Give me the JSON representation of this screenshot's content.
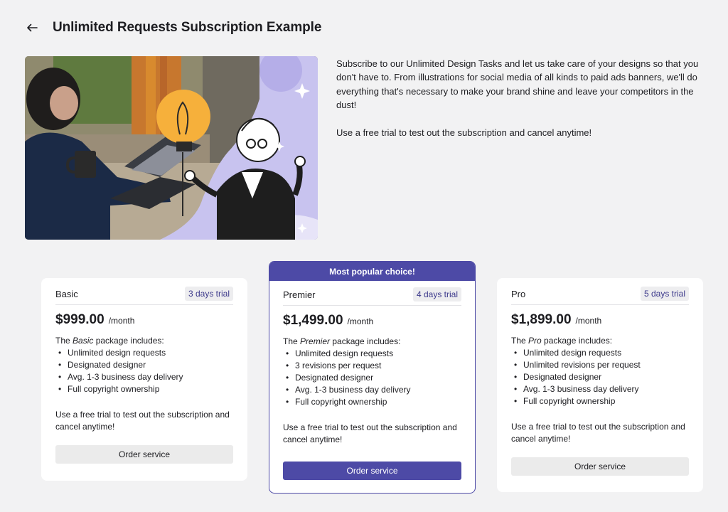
{
  "header": {
    "back_icon": "arrow-left-icon",
    "title": "Unlimited Requests Subscription Example"
  },
  "hero": {
    "image": "illustration-woman-laptop-and-cartoon-character-with-lightbulb"
  },
  "description": {
    "paragraph1": "Subscribe to our Unlimited Design Tasks and let us take care of your designs so that you don't have to. From illustrations for social media of all kinds to paid ads banners, we'll do everything that's necessary to make your brand shine and leave your competitors in the dust!",
    "paragraph2": "Use a free trial to test out the subscription and cancel anytime!"
  },
  "colors": {
    "accent": "#4d4aa6",
    "background": "#f2f2f3",
    "button_gray": "#ebebeb"
  },
  "plans": [
    {
      "name": "Basic",
      "trial": "3 days trial",
      "price": "$999.00",
      "period": "/month",
      "includes_prefix": "The ",
      "includes_name": "Basic",
      "includes_suffix": " package includes:",
      "features": [
        "Unlimited design requests",
        "Designated designer",
        "Avg. 1-3 business day delivery",
        "Full copyright ownership"
      ],
      "note": "Use a free trial to test out the subscription and cancel anytime!",
      "button": "Order service"
    },
    {
      "banner": "Most popular choice!",
      "name": "Premier",
      "trial": "4 days trial",
      "price": "$1,499.00",
      "period": "/month",
      "includes_prefix": "The ",
      "includes_name": "Premier",
      "includes_suffix": " package includes:",
      "features": [
        "Unlimited design requests",
        "3 revisions per request",
        "Designated designer",
        "Avg. 1-3 business day delivery",
        "Full copyright ownership"
      ],
      "note": "Use a free trial to test out the subscription and cancel anytime!",
      "button": "Order service"
    },
    {
      "name": "Pro",
      "trial": "5 days trial",
      "price": "$1,899.00",
      "period": "/month",
      "includes_prefix": "The ",
      "includes_name": "Pro",
      "includes_suffix": " package includes:",
      "features": [
        "Unlimited design requests",
        "Unlimited revisions per request",
        "Designated designer",
        "Avg. 1-3 business day delivery",
        "Full copyright ownership"
      ],
      "note": "Use a free trial to test out the subscription and cancel anytime!",
      "button": "Order service"
    }
  ]
}
